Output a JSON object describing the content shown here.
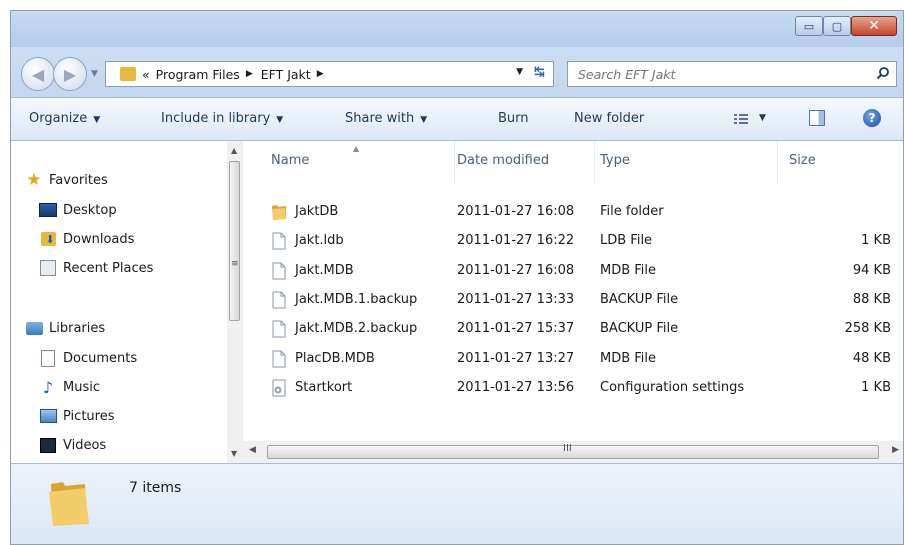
{
  "window": {
    "minimize_glyph": "▭",
    "maximize_glyph": "▢",
    "close_glyph": "✕"
  },
  "address": {
    "overflow": "«",
    "crumbs": [
      "Program Files",
      "EFT Jakt"
    ],
    "separator": "▶"
  },
  "search": {
    "placeholder": "Search EFT Jakt"
  },
  "toolbar": {
    "organize": "Organize",
    "include_in_library": "Include in library",
    "share_with": "Share with",
    "burn": "Burn",
    "new_folder": "New folder",
    "dropdown": "▼",
    "help": "?"
  },
  "nav": {
    "favorites": "Favorites",
    "desktop": "Desktop",
    "downloads": "Downloads",
    "recent_places": "Recent Places",
    "libraries": "Libraries",
    "documents": "Documents",
    "music": "Music",
    "pictures": "Pictures",
    "videos": "Videos"
  },
  "columns": {
    "name": "Name",
    "date": "Date modified",
    "type": "Type",
    "size": "Size"
  },
  "files": [
    {
      "name": "JaktDB",
      "date": "2011-01-27 16:08",
      "type": "File folder",
      "size": "",
      "icon": "folder-icon"
    },
    {
      "name": "Jakt.ldb",
      "date": "2011-01-27 16:22",
      "type": "LDB File",
      "size": "1 KB",
      "icon": "file-icon"
    },
    {
      "name": "Jakt.MDB",
      "date": "2011-01-27 16:08",
      "type": "MDB File",
      "size": "94 KB",
      "icon": "file-icon"
    },
    {
      "name": "Jakt.MDB.1.backup",
      "date": "2011-01-27 13:33",
      "type": "BACKUP File",
      "size": "88 KB",
      "icon": "file-icon"
    },
    {
      "name": "Jakt.MDB.2.backup",
      "date": "2011-01-27 15:37",
      "type": "BACKUP File",
      "size": "258 KB",
      "icon": "file-icon"
    },
    {
      "name": "PlacDB.MDB",
      "date": "2011-01-27 13:27",
      "type": "MDB File",
      "size": "48 KB",
      "icon": "file-icon"
    },
    {
      "name": "Startkort",
      "date": "2011-01-27 13:56",
      "type": "Configuration settings",
      "size": "1 KB",
      "icon": "config-file-icon"
    }
  ],
  "status": {
    "item_count": "7 items"
  },
  "colors": {
    "titlebar": "#c7daf1",
    "accent": "#1e395b",
    "folder": "#e7b83d",
    "close": "#c7442a"
  }
}
